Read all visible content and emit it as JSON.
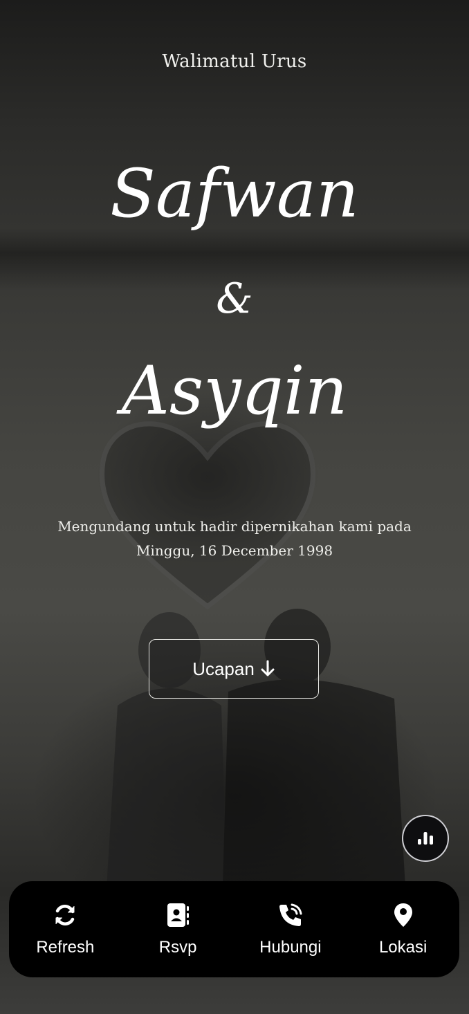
{
  "header": {
    "subtitle": "Walimatul Urus"
  },
  "couple": {
    "groom": "Safwan",
    "ampersand": "&",
    "bride": "Asyqin"
  },
  "invitation": {
    "line1": "Mengundang untuk hadir dipernikahan kami pada",
    "line2": "Minggu, 16 December 1998"
  },
  "ucapan_button": {
    "label": "Ucapan"
  },
  "nav": {
    "items": [
      {
        "label": "Refresh",
        "icon": "refresh-icon"
      },
      {
        "label": "Rsvp",
        "icon": "contact-book-icon"
      },
      {
        "label": "Hubungi",
        "icon": "phone-call-icon"
      },
      {
        "label": "Lokasi",
        "icon": "map-pin-icon"
      }
    ]
  },
  "fab": {
    "icon": "bar-chart-icon"
  },
  "colors": {
    "overlay": "#2a2a28",
    "nav_bg": "#000000",
    "text": "#ffffff"
  }
}
